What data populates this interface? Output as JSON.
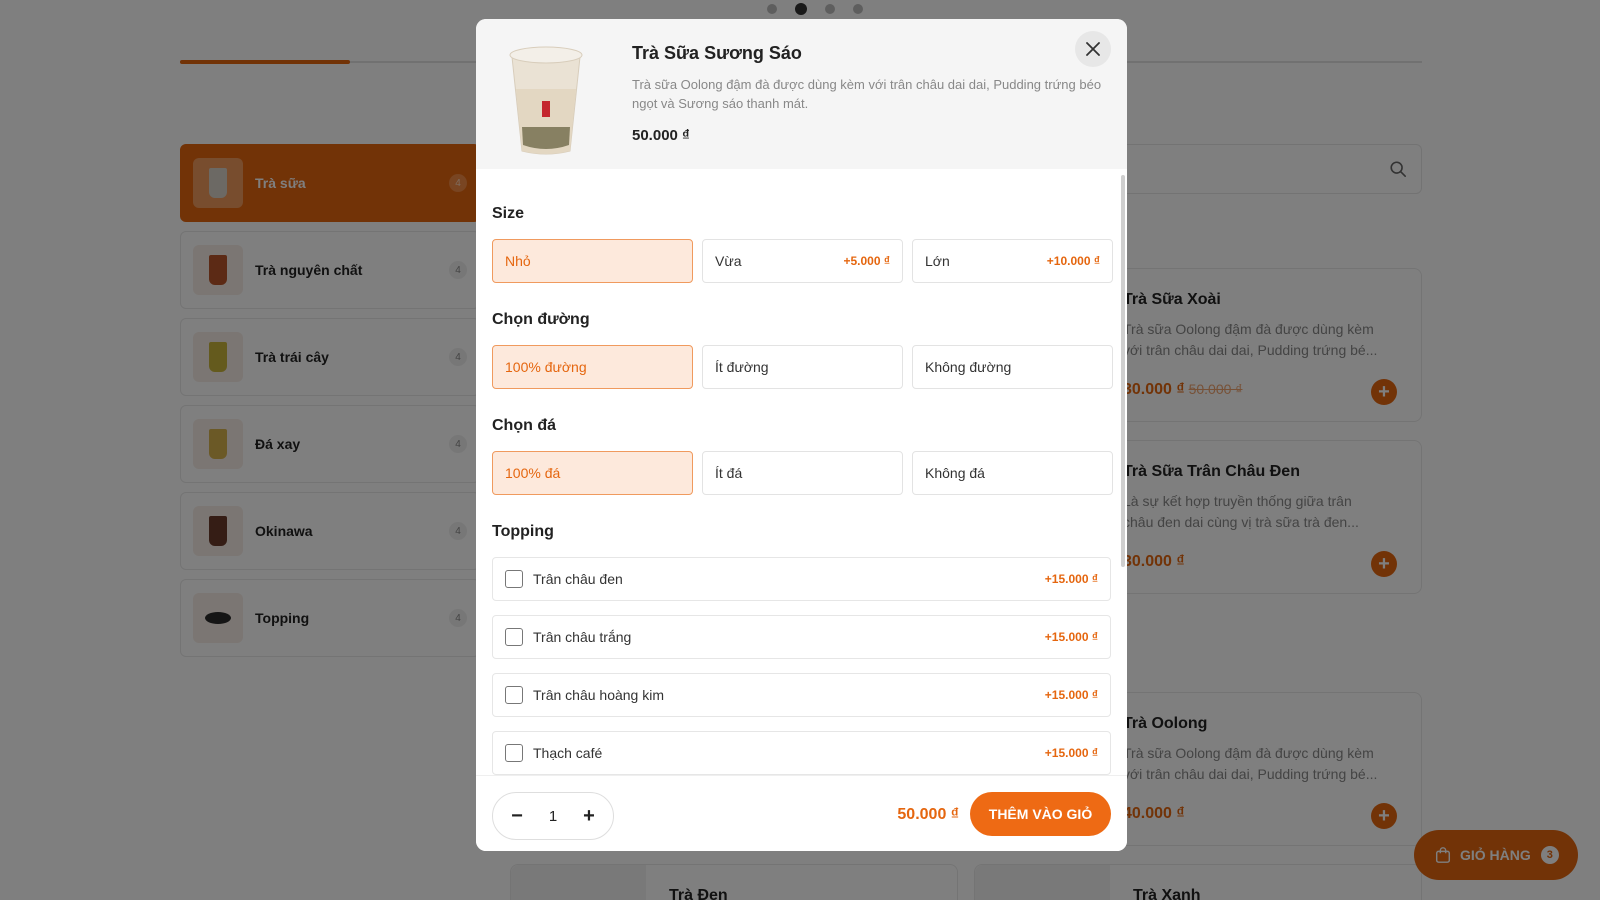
{
  "colors": {
    "accent": "#e5660f",
    "overlay": "rgba(0,0,0,0.5)"
  },
  "categories": [
    {
      "label": "Trà sữa",
      "count": "4",
      "active": true,
      "cup": "#d9d2c8"
    },
    {
      "label": "Trà nguyên chất",
      "count": "4",
      "cup": "#b8552a"
    },
    {
      "label": "Trà trái cây",
      "count": "4",
      "cup": "#c9b43a"
    },
    {
      "label": "Đá xay",
      "count": "4",
      "cup": "#d7b24c"
    },
    {
      "label": "Okinawa",
      "count": "4",
      "cup": "#6a3a2a"
    },
    {
      "label": "Topping",
      "count": "4",
      "cup": "#2b2b2b"
    }
  ],
  "products": [
    {
      "name": "Trà Sữa Xoài",
      "desc": "Trà sữa Oolong đậm đà được dùng kèm với trân châu dai dai, Pudding trứng bé...",
      "price": "30.000 ₫",
      "old_price": "50.000 ₫"
    },
    {
      "name": "Trà Sữa Trân Châu Đen",
      "desc": "Là sự kết hợp truyền thống giữa trân châu đen dai cùng vị trà sữa trà đen...",
      "price": "30.000 ₫"
    },
    {
      "name": "Trà Oolong",
      "desc": "Trà sữa Oolong đậm đà được dùng kèm với trân châu dai dai, Pudding trứng bé...",
      "price": "40.000 ₫"
    }
  ],
  "bottom_products": [
    "Trà Đen",
    "Trà Xanh"
  ],
  "cart": {
    "label": "GIỎ HÀNG",
    "count": "3"
  },
  "modal": {
    "title": "Trà Sữa Sương Sáo",
    "desc": "Trà sữa Oolong đậm đà được dùng kèm với trân châu dai dai, Pudding trứng béo ngọt và Sương sáo thanh mát.",
    "price": "50.000 ₫",
    "size": {
      "title": "Size",
      "options": [
        {
          "label": "Nhỏ",
          "extra": "",
          "selected": true
        },
        {
          "label": "Vừa",
          "extra": "+5.000 ₫"
        },
        {
          "label": "Lớn",
          "extra": "+10.000 ₫"
        }
      ]
    },
    "sugar": {
      "title": "Chọn đường",
      "options": [
        {
          "label": "100% đường",
          "selected": true
        },
        {
          "label": "Ít đường"
        },
        {
          "label": "Không đường"
        }
      ]
    },
    "ice": {
      "title": "Chọn đá",
      "options": [
        {
          "label": "100% đá",
          "selected": true
        },
        {
          "label": "Ít đá"
        },
        {
          "label": "Không đá"
        }
      ]
    },
    "topping": {
      "title": "Topping",
      "items": [
        {
          "label": "Trân châu đen",
          "price": "+15.000 ₫",
          "checked": false
        },
        {
          "label": "Trân châu trắng",
          "price": "+15.000 ₫",
          "checked": false
        },
        {
          "label": "Trân châu hoàng kim",
          "price": "+15.000 ₫",
          "checked": false
        },
        {
          "label": "Thạch café",
          "price": "+15.000 ₫",
          "checked": false
        }
      ]
    },
    "footer": {
      "quantity": "1",
      "minus": "−",
      "plus": "+",
      "total": "50.000 ₫",
      "add_label": "THÊM VÀO GIỎ"
    }
  }
}
